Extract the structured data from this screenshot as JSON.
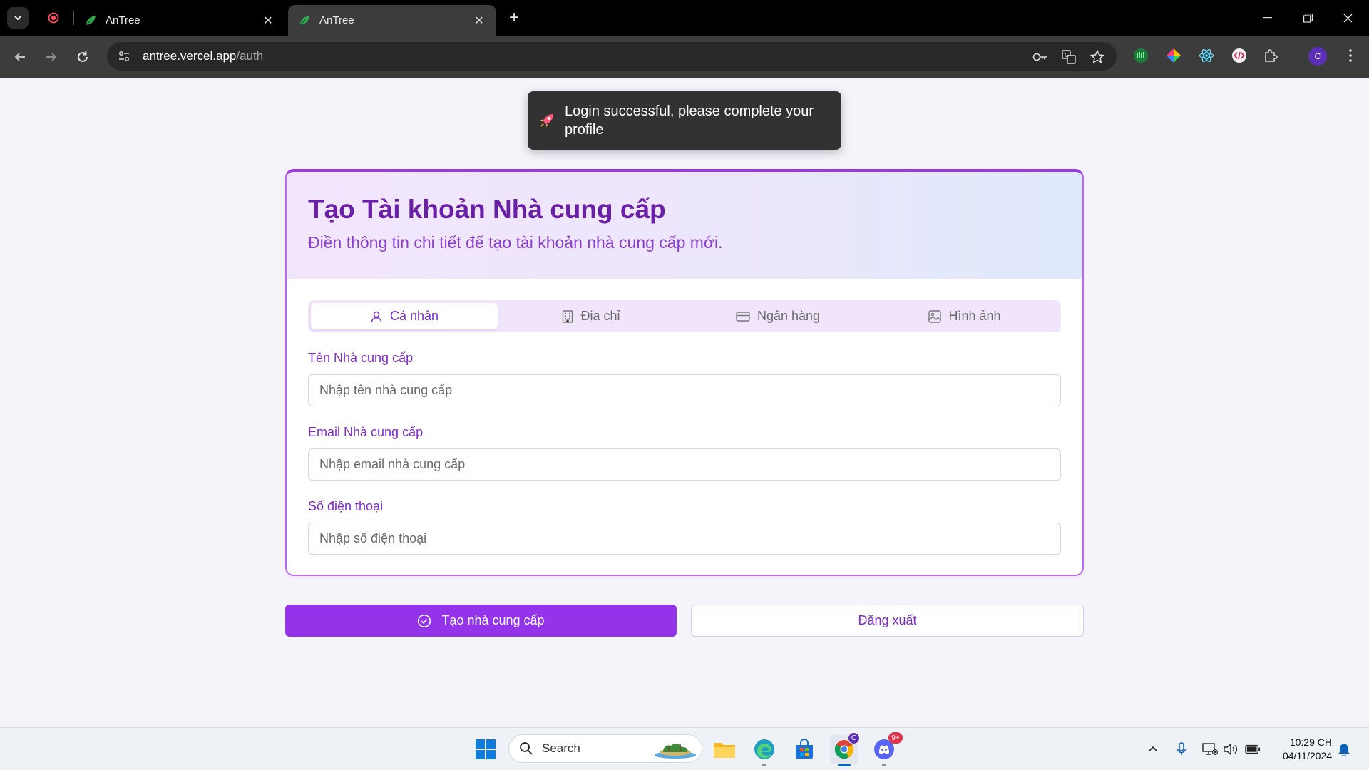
{
  "browser": {
    "tabs": [
      {
        "title": "AnTree",
        "active": false
      },
      {
        "title": "AnTree",
        "active": true
      }
    ],
    "url_host": "antree.vercel.app",
    "url_path": "/auth",
    "profile_initial": "C"
  },
  "toast": {
    "message": "Login successful, please complete your profile",
    "icon": "rocket-icon"
  },
  "form": {
    "title": "Tạo Tài khoản Nhà cung cấp",
    "subtitle": "Điền thông tin chi tiết để tạo tài khoản nhà cung cấp mới.",
    "tabs": [
      {
        "label": "Cá nhân",
        "icon": "user-icon",
        "active": true
      },
      {
        "label": "Địa chỉ",
        "icon": "building-icon",
        "active": false
      },
      {
        "label": "Ngân hàng",
        "icon": "credit-card-icon",
        "active": false
      },
      {
        "label": "Hình ảnh",
        "icon": "image-icon",
        "active": false
      }
    ],
    "fields": [
      {
        "label": "Tên Nhà cung cấp",
        "placeholder": "Nhập tên nhà cung cấp",
        "value": ""
      },
      {
        "label": "Email Nhà cung cấp",
        "placeholder": "Nhập email nhà cung cấp",
        "value": ""
      },
      {
        "label": "Số điện thoại",
        "placeholder": "Nhập số điện thoại",
        "value": ""
      }
    ],
    "submit_label": "Tạo nhà cung cấp",
    "logout_label": "Đăng xuất"
  },
  "taskbar": {
    "search_label": "Search",
    "time": "10:29 CH",
    "date": "04/11/2024",
    "chrome_badge": "C",
    "discord_badge": "9+"
  },
  "colors": {
    "accent": "#9333ea",
    "title": "#6a1fa8",
    "label": "#7e2cc8"
  }
}
